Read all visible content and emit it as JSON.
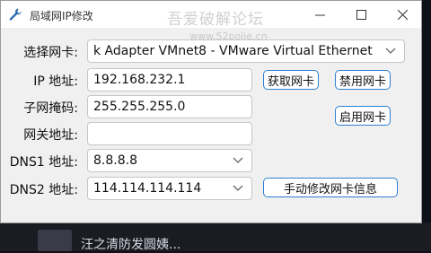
{
  "window": {
    "title": "局域网IP修改",
    "watermark": "吾爱破解论坛",
    "watermark_url": "www.52pojie.cn",
    "controls": [
      "minimize",
      "maximize",
      "close"
    ]
  },
  "form": {
    "adapter_label": "选择网卡:",
    "adapter_value": "k Adapter VMnet8 - VMware Virtual Ethernet",
    "ip_label": "IP 地址:",
    "ip_value": "192.168.232.1",
    "mask_label": "子网掩码:",
    "mask_value": "255.255.255.0",
    "gateway_label": "网关地址:",
    "gateway_value": "",
    "dns1_label": "DNS1 地址:",
    "dns1_value": "8.8.8.8",
    "dns2_label": "DNS2 地址:",
    "dns2_value": "114.114.114.114"
  },
  "buttons": {
    "get_adapter": "获取网卡",
    "disable_adapter": "禁用网卡",
    "enable_adapter": "启用网卡",
    "manual_modify": "手动修改网卡信息"
  },
  "background": {
    "text": "汪之清防发圆姨..."
  },
  "colors": {
    "accent": "#2d7fd1",
    "window_bg": "#f0f0f0",
    "titlebar_bg": "#ffffff"
  }
}
